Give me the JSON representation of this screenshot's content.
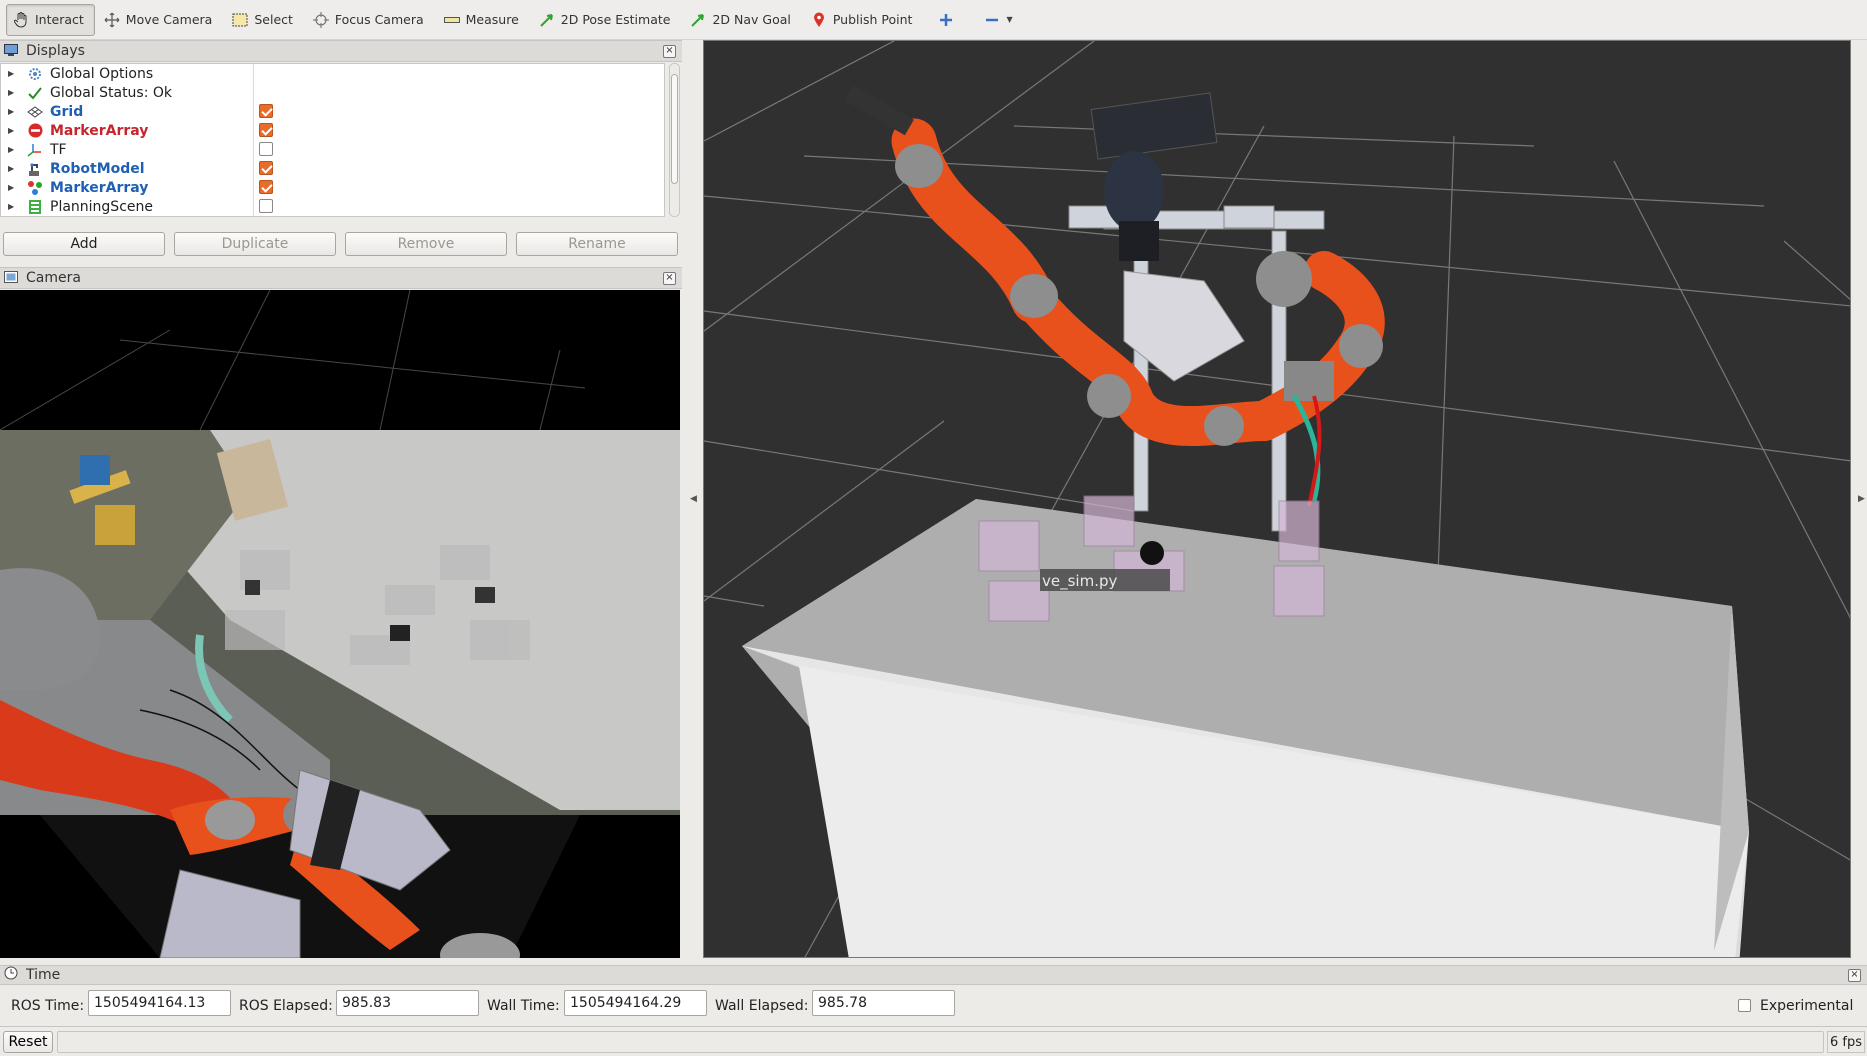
{
  "toolbar": {
    "tools": [
      {
        "label": "Interact",
        "icon": "hand-icon"
      },
      {
        "label": "Move Camera",
        "icon": "move-camera-icon"
      },
      {
        "label": "Select",
        "icon": "select-icon"
      },
      {
        "label": "Focus Camera",
        "icon": "focus-camera-icon"
      },
      {
        "label": "Measure",
        "icon": "ruler-icon"
      },
      {
        "label": "2D Pose Estimate",
        "icon": "pose-arrow-icon"
      },
      {
        "label": "2D Nav Goal",
        "icon": "nav-goal-arrow-icon"
      },
      {
        "label": "Publish Point",
        "icon": "map-pin-icon"
      }
    ],
    "active_tool": "Interact"
  },
  "displays": {
    "title": "Displays",
    "items": [
      {
        "label": "Global Options",
        "checked": null,
        "style": "plain"
      },
      {
        "label": "Global Status: Ok",
        "checked": null,
        "style": "plain"
      },
      {
        "label": "Grid",
        "checked": true,
        "style": "blue"
      },
      {
        "label": "MarkerArray",
        "checked": true,
        "style": "red"
      },
      {
        "label": "TF",
        "checked": false,
        "style": "plain"
      },
      {
        "label": "RobotModel",
        "checked": true,
        "style": "blue"
      },
      {
        "label": "MarkerArray",
        "checked": true,
        "style": "blue"
      },
      {
        "label": "PlanningScene",
        "checked": false,
        "style": "plain"
      }
    ],
    "buttons": {
      "add": "Add",
      "duplicate": "Duplicate",
      "remove": "Remove",
      "rename": "Rename"
    }
  },
  "camera": {
    "title": "Camera"
  },
  "view3d": {
    "tooltip": "ve_sim.py"
  },
  "time": {
    "title": "Time",
    "ros_time_label": "ROS Time:",
    "ros_time": "1505494164.13",
    "ros_elapsed_label": "ROS Elapsed:",
    "ros_elapsed": "985.83",
    "wall_time_label": "Wall Time:",
    "wall_time": "1505494164.29",
    "wall_elapsed_label": "Wall Elapsed:",
    "wall_elapsed": "985.78",
    "experimental_label": "Experimental",
    "experimental": false
  },
  "status": {
    "reset_label": "Reset",
    "fps": "6 fps"
  },
  "colors": {
    "checkbox_on": "#e86c2a",
    "robot_orange": "#e8501c",
    "view_bg": "#303030"
  }
}
